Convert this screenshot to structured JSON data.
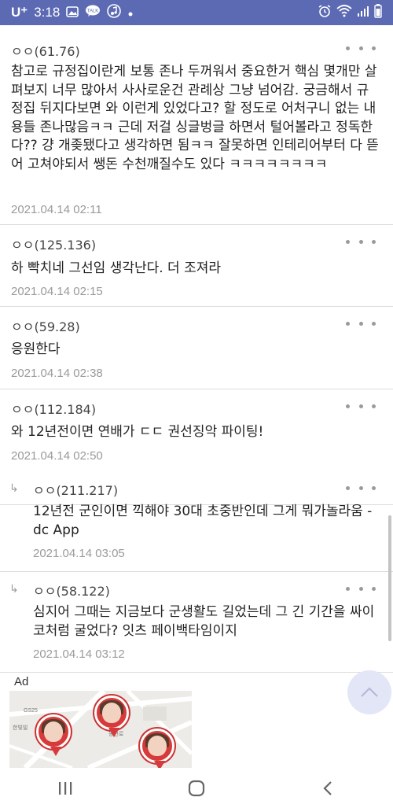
{
  "status_bar": {
    "carrier": "U⁺",
    "time": "3:18",
    "icons": [
      "image-icon",
      "talk-icon",
      "music-icon",
      "dot-icon",
      "alarm-icon",
      "wifi-icon",
      "signal-icon",
      "battery-icon"
    ]
  },
  "comments": [
    {
      "author": "ㅇㅇ(61.76)",
      "body": "참고로 규정집이란게 보통 존나 두꺼워서 중요한거 핵심 몇개만 살펴보지 너무 많아서 사사로운건 관례상 그냥 넘어감. 궁금해서 규정집 뒤지다보면 와 이런게 있었다고? 할 정도로 어처구니 없는 내용들 존나많음ㅋㅋ 근데 저걸 싱글벙글 하면서 털어볼라고 정독한다?? 걍 개좆됐다고 생각하면 됨ㅋㅋ 잘못하면 인테리어부터 다 뜯어 고쳐야되서 쌩돈 수천깨질수도 있다 ㅋㅋㅋㅋㅋㅋㅋㅋ",
      "date": "2021.04.14 02:11"
    },
    {
      "author": "ㅇㅇ(125.136)",
      "body": "하 빡치네 그선임 생각난다. 더 조져라",
      "date": "2021.04.14 02:15"
    },
    {
      "author": "ㅇㅇ(59.28)",
      "body": "응원한다",
      "date": "2021.04.14 02:38"
    },
    {
      "author": "ㅇㅇ(112.184)",
      "body": "와 12년전이면 연배가 ㄷㄷ 권선징악 파이팅!",
      "date": "2021.04.14 02:50"
    },
    {
      "reply": true,
      "author": "ㅇㅇ(211.217)",
      "body": "12년전 군인이면 끽해야 30대 초중반인데 그게 뭐가놀라움 - dc App",
      "date": "2021.04.14 03:05"
    },
    {
      "reply": true,
      "author": "ㅇㅇ(58.122)",
      "body": "심지어 그때는 지금보다 군생활도 길었는데 그 긴 기간을 싸이코처럼 굴었다? 잇츠 페이백타임이지",
      "date": "2021.04.14 03:12"
    }
  ],
  "reply_arrow": "↳",
  "ad": {
    "label": "Ad",
    "map_labels": [
      "GS25",
      "한빛빌",
      "동천로"
    ]
  },
  "colors": {
    "status_bar": "#5b6ab3",
    "date_text": "#9a9a9a",
    "divider": "#dcdcdc",
    "to_top_button": "#e3e6f6",
    "pin": "#d63a3a"
  }
}
